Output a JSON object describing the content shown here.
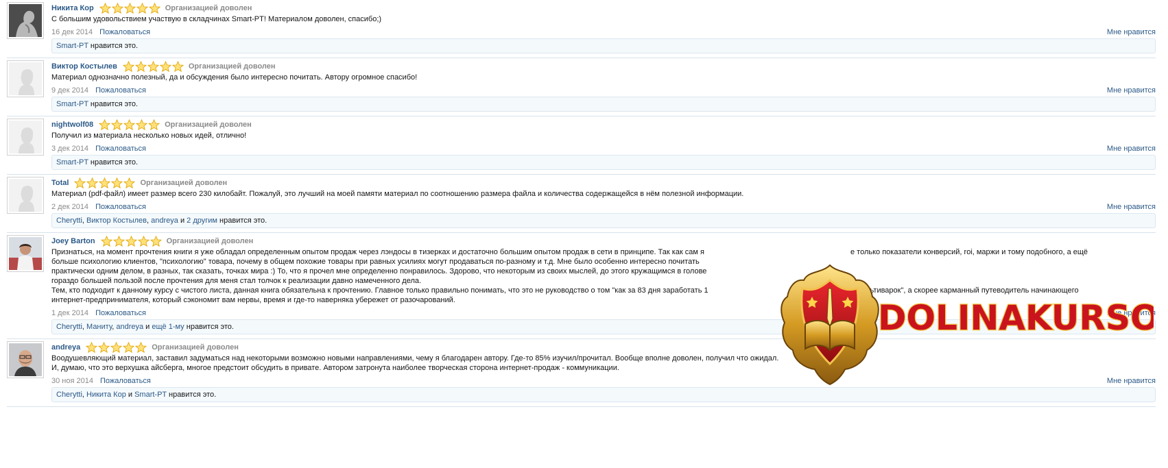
{
  "likes_suffix": "нравится это.",
  "report_label": "Пожаловаться",
  "like_label": "Мне нравится",
  "verdict": "Организацией доволен",
  "reviews": [
    {
      "name": "Никита Кор",
      "text": [
        "С большим удовольствием участвую в складчинах Smart-PT! Материалом доволен, спасибо;)"
      ],
      "date": "16 дек 2014",
      "likes": [
        {
          "who": [
            "Smart-PT"
          ],
          "seps": []
        }
      ]
    },
    {
      "name": "Виктор Костылев",
      "text": [
        "Материал однозначно полезный, да и обсуждения было интересно почитать. Автору огромное спасибо!"
      ],
      "date": "9 дек 2014",
      "likes": [
        {
          "who": [
            "Smart-PT"
          ],
          "seps": []
        }
      ]
    },
    {
      "name": "nightwolf08",
      "text": [
        "Получил из материала несколько новых идей, отлично!"
      ],
      "date": "3 дек 2014",
      "likes": [
        {
          "who": [
            "Smart-PT"
          ],
          "seps": []
        }
      ]
    },
    {
      "name": "Total",
      "text": [
        "Материал (pdf-файл) имеет размер всего 230 килобайт. Пожалуй, это лучший на моей памяти материал по соотношению размера файла и количества содержащейся в нём полезной информации."
      ],
      "date": "2 дек 2014",
      "likes": [
        {
          "who": [
            "Cherytti",
            "Виктор Костылев",
            "andreya",
            "2 другим"
          ],
          "seps": [
            ", ",
            ", ",
            " и "
          ]
        }
      ]
    },
    {
      "name": "Joey Barton",
      "text": [
        "Признаться, на момент прочтения книги я уже обладал определенным опытом продаж через лэндосы в тизерках и достаточно большим опытом продаж в сети в принципе. Так как сам я",
        "больше психологию клиентов, \"психологию\" товара, почему в общем похожие товары при равных усилиях могут продаваться по-разному и т.д. Мне было особенно интересно почитать",
        "практически одним делом, в разных, так сказать, точках мира :) То, что я прочел мне определенно понравилось. Здорово, что некоторым из своих мыслей, до этого кружащимся в голове",
        "гораздо большей пользой после прочтения для меня стал толчок к реализации давно намеченного дела.",
        "Тем, кто подходит к данному курсу с чистого листа, данная книга обязательна к прочтению. Главное только правильно понимать, что это не руководство о том \"как за 83 дня заработать 1",
        "интернет-предпринимателя, который сэкономит вам нервы, время и где-то наверняка убережет от разочарований."
      ],
      "text_right": [
        "е только показатели конверсий, roi, маржи и тому подобного, а ещё",
        "",
        "",
        "",
        "е мультиварок\", а скорее карманный путеводитель начинающего",
        ""
      ],
      "date": "1 дек 2014",
      "likes": [
        {
          "who": [
            "Cherytti",
            "Маниту",
            "andreya",
            "ещё 1-му"
          ],
          "seps": [
            ", ",
            ", ",
            " и "
          ]
        }
      ]
    },
    {
      "name": "andreya",
      "text": [
        "Воодушевляющий материал, заставил задуматься над некоторыми возможно новыми направлениями, чему я благодарен автору. Где-то 85% изучил/прочитал. Вообще вполне доволен, получил что ожидал.",
        "И, думаю, что это верхушка айсберга, многое предстоит обсудить в привате. Автором затронута наиболее творческая сторона интернет-продаж - коммуникации."
      ],
      "date": "30 ноя 2014",
      "likes": [
        {
          "who": [
            "Cherytti",
            "Никита Кор",
            "Smart-PT"
          ],
          "seps": [
            ", ",
            " и "
          ]
        }
      ]
    }
  ],
  "watermark": {
    "text": "DOLINAKURSOV",
    "color": "#c9141d"
  }
}
